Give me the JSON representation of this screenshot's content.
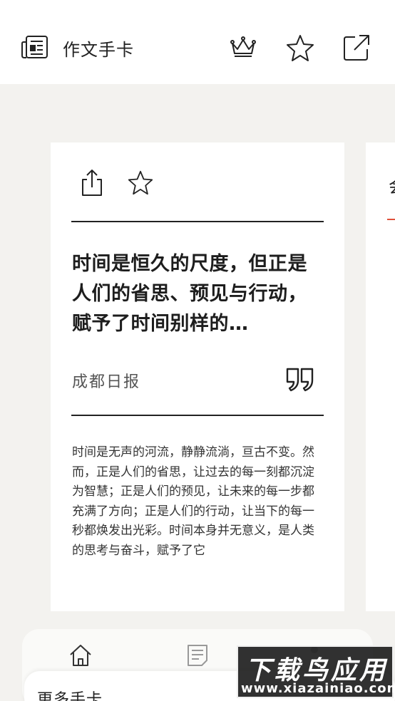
{
  "header": {
    "title": "作文手卡",
    "icons": [
      "newspaper-icon",
      "crown-icon",
      "star-icon",
      "share-icon"
    ]
  },
  "card": {
    "icons": [
      "share-icon",
      "star-icon"
    ],
    "headline": "时间是恒久的尺度，但正是人们的省思、预见与行动，赋予了时间别样的…",
    "source": "成都日报",
    "quote_icon": "quote-icon",
    "body": "时间是无声的河流，静静流淌，亘古不变。然而，正是人们的省思，让过去的每一刻都沉淀为智慧；正是人们的预见，让未来的每一步都充满了方向；正是人们的行动，让当下的每一秒都焕发出光彩。时间本身并无意义，是人类的思考与奋斗，赋予了它"
  },
  "peek_card": {
    "partial_char": "会"
  },
  "bottom_nav": {
    "items": [
      "home-icon",
      "document-icon"
    ]
  },
  "sheet": {
    "title": "更多手卡"
  },
  "watermark": {
    "main": "下载鸟应用",
    "url": "www.xiazainiao.com"
  },
  "colors": {
    "background": "#f3f2ef",
    "card": "#ffffff",
    "accent": "#e0503a",
    "text": "#1d1d1d"
  }
}
